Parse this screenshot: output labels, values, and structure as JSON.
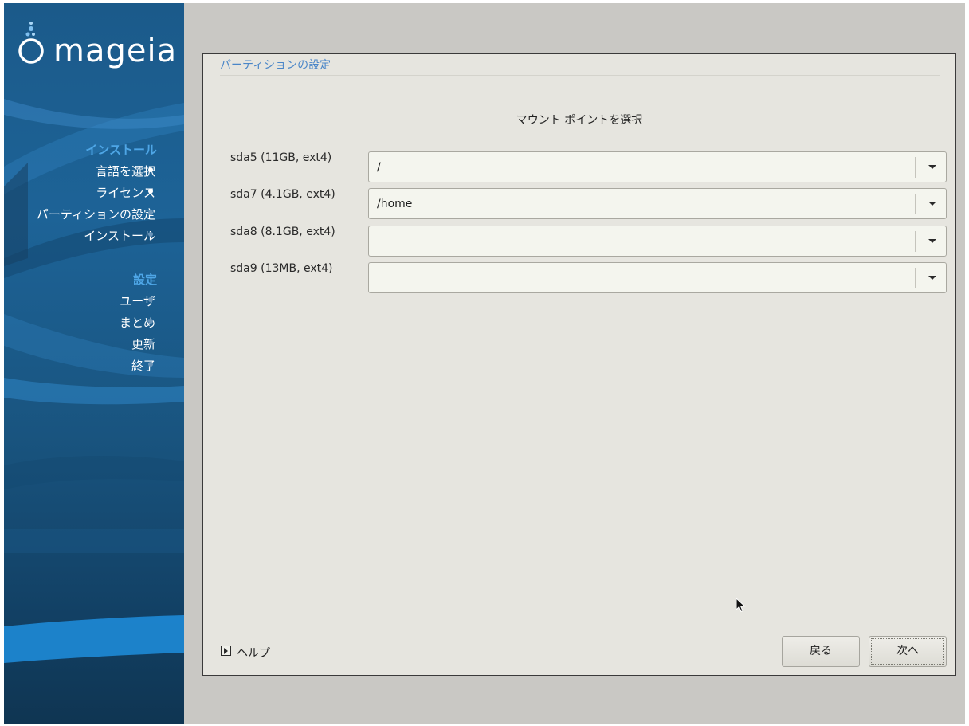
{
  "brand": {
    "name": "mageia"
  },
  "sidebar": {
    "sections": [
      {
        "title": "インストール",
        "items": [
          {
            "label": "言語を選択",
            "state": "done"
          },
          {
            "label": "ライセンス",
            "state": "done"
          },
          {
            "label": "パーティションの設定",
            "state": "current"
          },
          {
            "label": "インストール",
            "state": "pending"
          }
        ]
      },
      {
        "title": "設定",
        "items": [
          {
            "label": "ユーザ",
            "state": "pending"
          },
          {
            "label": "まとめ",
            "state": "pending"
          },
          {
            "label": "更新",
            "state": "pending"
          },
          {
            "label": "終了",
            "state": "pending"
          }
        ]
      }
    ]
  },
  "panel": {
    "title": "パーティションの設定",
    "heading": "マウント ポイントを選択",
    "partitions": [
      {
        "label": "sda5 (11GB, ext4)",
        "mount": "/"
      },
      {
        "label": "sda7 (4.1GB, ext4)",
        "mount": "/home"
      },
      {
        "label": "sda8 (8.1GB, ext4)",
        "mount": ""
      },
      {
        "label": "sda9 (13MB, ext4)",
        "mount": ""
      }
    ],
    "help_label": "ヘルプ",
    "back_label": "戻る",
    "next_label": "次へ"
  },
  "colors": {
    "accent": "#4ea6e6",
    "panel_title": "#4a86c8",
    "sidebar_bg": "#1d6397",
    "panel_bg": "#e6e5df",
    "desktop_bg": "#c9c8c4"
  },
  "icons": {
    "logo": "mageia-logo-icon",
    "combo_arrow": "chevron-down-icon",
    "help_toggle": "expander-arrow-icon",
    "cursor": "mouse-pointer-icon"
  }
}
